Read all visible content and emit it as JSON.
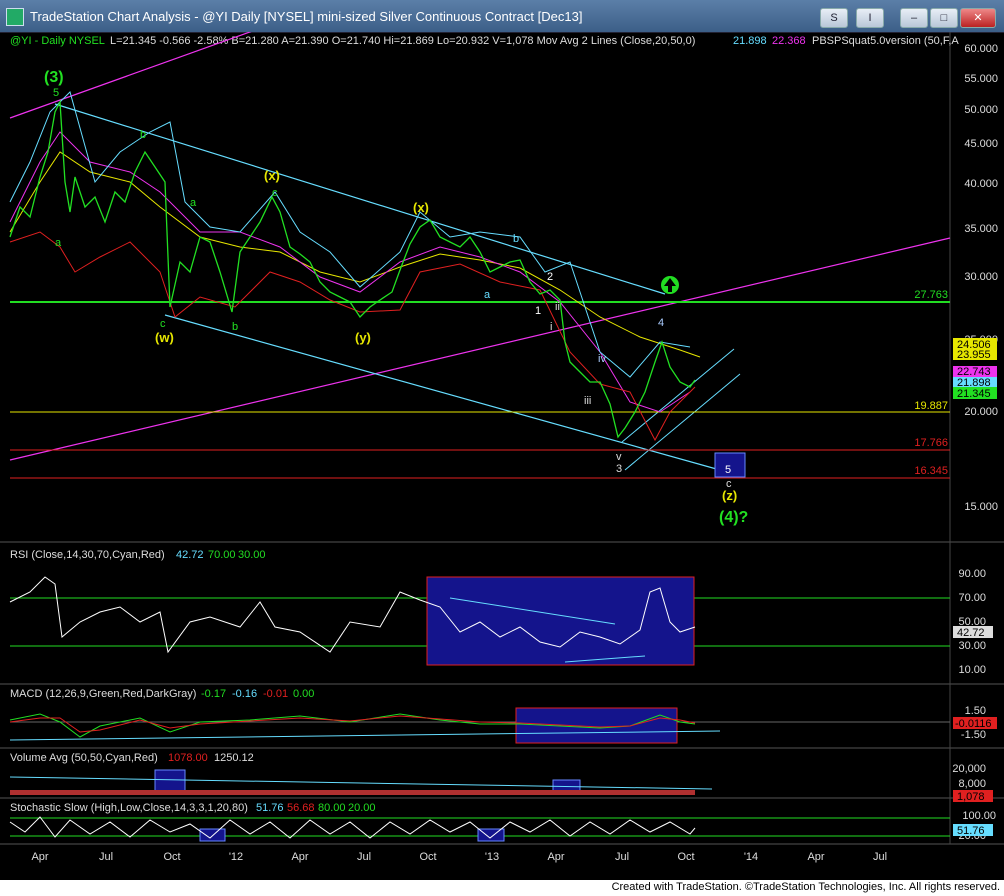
{
  "window": {
    "title": "TradeStation Chart Analysis - @YI Daily [NYSEL] mini-sized Silver Continuous Contract [Dec13]",
    "s_label": "S",
    "i_label": "I",
    "min_glyph": "–",
    "max_glyph": "□",
    "close_glyph": "✕"
  },
  "header": {
    "symbol": "@YI - Daily  NYSEL",
    "ohlc": "L=21.345  -0.566  -2.58%  B=21.280  A=21.390  O=21.740  Hi=21.869  Lo=20.932  V=1,078  Mov Avg 2 Lines (Close,20,50,0)",
    "ma1": "21.898",
    "ma2": "22.368",
    "indicator": "PBSPSquat5.0version (50,F,A"
  },
  "colors": {
    "price": "#22e022",
    "cyan": "#66ddff",
    "magenta": "#ee33ee",
    "yellow": "#e6e600",
    "red": "#e02020",
    "green_line": "#22dd22",
    "blue_box": "#14148c"
  },
  "price_axis": {
    "ticks": [
      "60.000",
      "55.000",
      "50.000",
      "45.000",
      "40.000",
      "35.000",
      "30.000",
      "25.000",
      "20.000",
      "15.000"
    ],
    "levels": [
      {
        "label": "27.763"
      },
      {
        "label": "19.887"
      },
      {
        "label": "17.766"
      },
      {
        "label": "16.345"
      }
    ],
    "tags": [
      {
        "label": "24.506"
      },
      {
        "label": "23.955"
      },
      {
        "label": "22.743"
      },
      {
        "label": "21.898"
      },
      {
        "label": "21.345"
      }
    ]
  },
  "wave_labels": [
    {
      "text": "(3)"
    },
    {
      "text": "5"
    },
    {
      "text": "a"
    },
    {
      "text": "b"
    },
    {
      "text": "a"
    },
    {
      "text": "c"
    },
    {
      "text": "(w)"
    },
    {
      "text": "b"
    },
    {
      "text": "(x)"
    },
    {
      "text": "c"
    },
    {
      "text": "(y)"
    },
    {
      "text": "(x)"
    },
    {
      "text": "a"
    },
    {
      "text": "b"
    },
    {
      "text": "1"
    },
    {
      "text": "2"
    },
    {
      "text": "i"
    },
    {
      "text": "ii"
    },
    {
      "text": "iii"
    },
    {
      "text": "iv"
    },
    {
      "text": "v"
    },
    {
      "text": "3"
    },
    {
      "text": "4"
    },
    {
      "text": "5"
    },
    {
      "text": "c"
    },
    {
      "text": "(z)"
    },
    {
      "text": "(4)?"
    }
  ],
  "rsi": {
    "label": "RSI (Close,14,30,70,Cyan,Red)",
    "value": "42.72",
    "v70": "70.00",
    "v30": "30.00",
    "ticks": [
      "90.00",
      "70.00",
      "50.00",
      "30.00",
      "10.00"
    ],
    "tag": "42.72"
  },
  "macd": {
    "label": "MACD (12,26,9,Green,Red,DarkGray)",
    "v1": "-0.17",
    "v2": "-0.16",
    "v3": "-0.01",
    "v4": "0.00",
    "ticks": [
      "1.50",
      "-1.50"
    ],
    "tag": "-0.0116"
  },
  "volume": {
    "label": "Volume Avg (50,50,Cyan,Red)",
    "v1": "1078.00",
    "v2": "1250.12",
    "ticks": [
      "20,000",
      "8,000"
    ],
    "tag": "1,078"
  },
  "stoch": {
    "label": "Stochastic Slow (High,Low,Close,14,3,3,1,20,80)",
    "v1": "51.76",
    "v2": "56.68",
    "v3": "80.00",
    "v4": "20.00",
    "ticks": [
      "100.00",
      "20.00"
    ],
    "tag": "51.76"
  },
  "time_axis": [
    "Apr",
    "Jul",
    "Oct",
    "'12",
    "Apr",
    "Jul",
    "Oct",
    "'13",
    "Apr",
    "Jul",
    "Oct",
    "'14",
    "Apr",
    "Jul"
  ],
  "footer": "Created with TradeStation. ©TradeStation Technologies, Inc. All rights reserved."
}
